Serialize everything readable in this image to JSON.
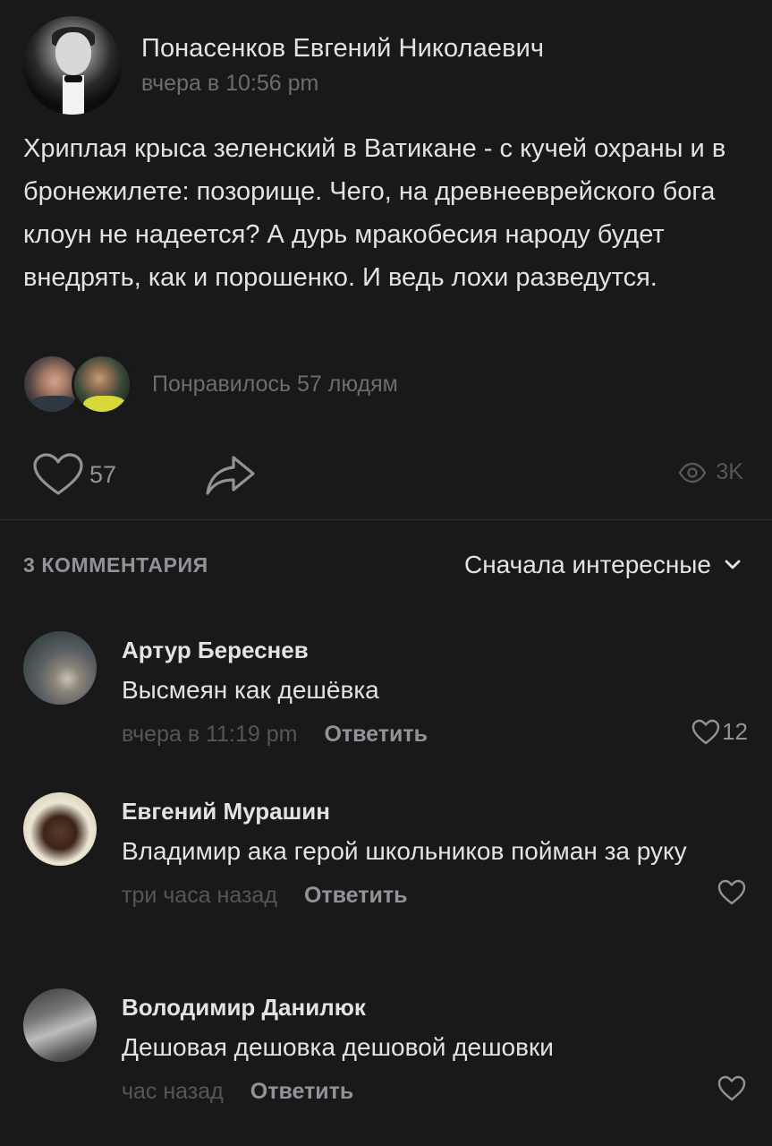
{
  "post": {
    "author_name": "Понасенков Евгений Николаевич",
    "time": "вчера в 10:56 pm",
    "text": "Хриплая крыса зеленский в Ватикане - с кучей охраны и в бронежилете: позорище. Чего, на древнееврейского бога клоун не надеется? А дурь мракобесия народу будет внедрять, как и порошенко. И ведь лохи разведутся.",
    "likes_summary": "Понравилось 57 людям",
    "like_count": "57",
    "views_count": "3K"
  },
  "comments_header": {
    "count_label": "3 КОММЕНТАРИЯ",
    "sort_label": "Сначала интересные"
  },
  "comments": [
    {
      "author": "Артур Береснев",
      "text": "Высмеян как дешёвка",
      "time": "вчера в 11:19 pm",
      "reply_label": "Ответить",
      "like_count": "12"
    },
    {
      "author": "Евгений Мурашин",
      "text": "Владимир ака герой школьников пойман за руку",
      "time": "три часа назад",
      "reply_label": "Ответить",
      "like_count": ""
    },
    {
      "author": "Володимир Данилюк",
      "text": "Дешовая дешовка дешовой дешовки",
      "time": "час назад",
      "reply_label": "Ответить",
      "like_count": ""
    }
  ],
  "icons": {
    "like": "heart-icon",
    "share": "share-arrow-icon",
    "views": "eye-icon",
    "sort": "chevron-down-icon"
  },
  "colors": {
    "background": "#19191a",
    "primary_text": "#e1e3e6",
    "secondary_text": "#929398",
    "muted_text": "#6c6d70"
  }
}
